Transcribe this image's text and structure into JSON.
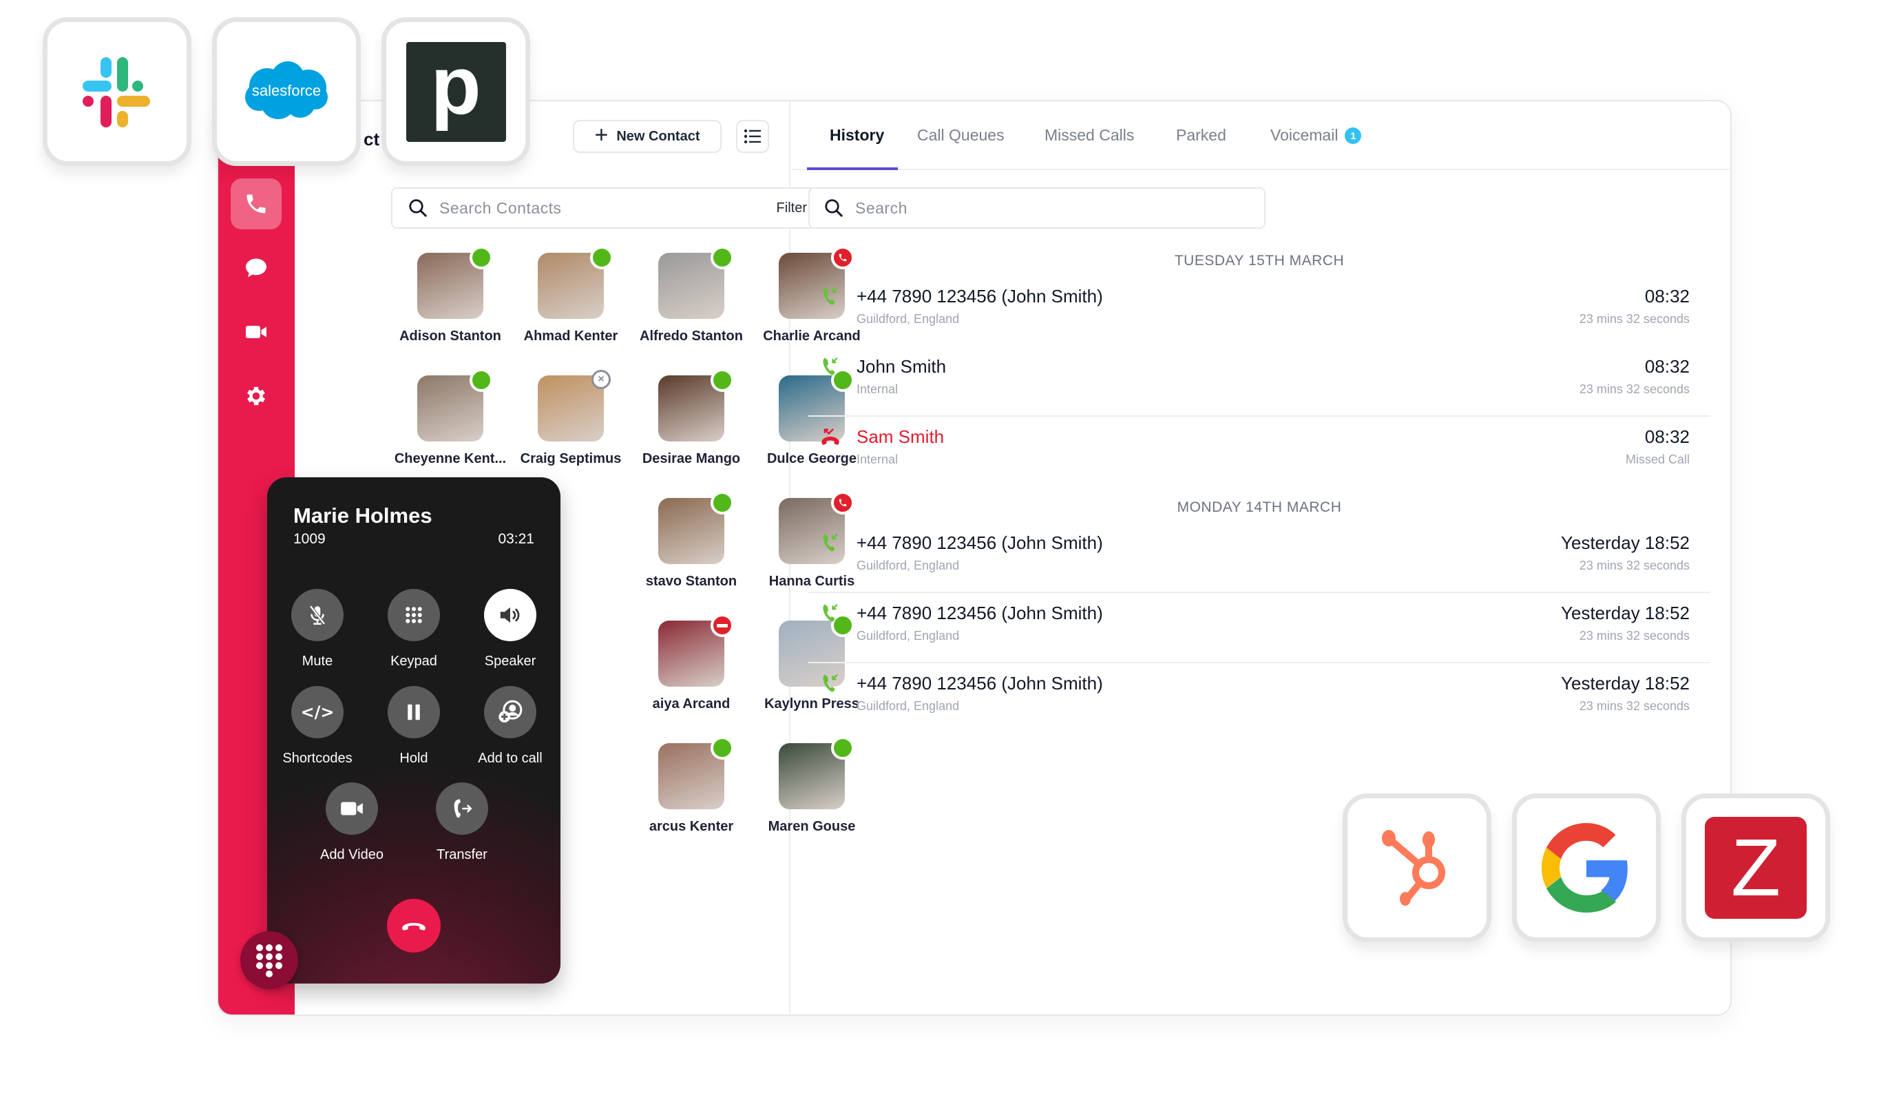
{
  "integrations_top": [
    {
      "name": "Slack",
      "icon": "slack-logo-icon"
    },
    {
      "name": "Salesforce",
      "icon": "salesforce-logo-icon",
      "text": "salesforce"
    },
    {
      "name": "Pipedrive",
      "icon": "pipedrive-logo-icon",
      "text": "p"
    }
  ],
  "integrations_bottom": [
    {
      "name": "HubSpot",
      "icon": "hubspot-logo-icon"
    },
    {
      "name": "Google",
      "icon": "google-logo-icon"
    },
    {
      "name": "Zoho",
      "icon": "zoho-logo-icon",
      "text": "Z"
    }
  ],
  "sidebar": {
    "items": [
      {
        "icon": "phone-icon",
        "label": "Calls",
        "active": true
      },
      {
        "icon": "chat-icon",
        "label": "Messages"
      },
      {
        "icon": "video-icon",
        "label": "Video"
      },
      {
        "icon": "gear-icon",
        "label": "Settings"
      }
    ],
    "accent": "#e91a4c"
  },
  "contacts": {
    "title_partial": "ct",
    "new_contact_label": "New Contact",
    "search_placeholder": "Search Contacts",
    "filter_label": "Filter",
    "list": [
      {
        "name": "Adison Stanton",
        "status": "online",
        "bg": "#8a6a5a"
      },
      {
        "name": "Ahmad Kenter",
        "status": "online",
        "bg": "#b08a68"
      },
      {
        "name": "Alfredo Stanton",
        "status": "online",
        "bg": "#9a9a9a"
      },
      {
        "name": "Charlie Arcand",
        "status": "on-call",
        "bg": "#6b4a3a"
      },
      {
        "name": "Cheyenne Kent...",
        "status": "online",
        "bg": "#8c7868"
      },
      {
        "name": "Craig Septimus",
        "status": "offline",
        "bg": "#c09060"
      },
      {
        "name": "Desirae Mango",
        "status": "online",
        "bg": "#5a3a2a"
      },
      {
        "name": "Dulce George",
        "status": "online",
        "bg": "#2a6a8a"
      },
      {
        "name": "stavo Stanton",
        "status": "online",
        "bg": "#8a6a50"
      },
      {
        "name": "Hanna Curtis",
        "status": "on-call",
        "bg": "#7a6a60"
      },
      {
        "name": "aiya Arcand",
        "status": "dnd",
        "bg": "#8a2a35"
      },
      {
        "name": "Kaylynn Press",
        "status": "online",
        "bg": "#a0b0c0"
      },
      {
        "name": "arcus Kenter",
        "status": "online",
        "bg": "#9a7060"
      },
      {
        "name": "Maren Gouse",
        "status": "online",
        "bg": "#3a4a3a"
      }
    ],
    "status_colors": {
      "online": "#52b81a",
      "on-call": "#e0202a",
      "dnd": "#e0202a",
      "offline": "#ffffff"
    }
  },
  "active_call": {
    "name": "Marie Holmes",
    "extension": "1009",
    "duration": "03:21",
    "controls": [
      {
        "label": "Mute",
        "icon": "mic-off-icon"
      },
      {
        "label": "Keypad",
        "icon": "keypad-icon"
      },
      {
        "label": "Speaker",
        "icon": "speaker-icon",
        "active": true
      },
      {
        "label": "Shortcodes",
        "icon": "code-icon"
      },
      {
        "label": "Hold",
        "icon": "pause-icon"
      },
      {
        "label": "Add to call",
        "icon": "add-user-icon"
      },
      {
        "label": "Add Video",
        "icon": "video-icon"
      },
      {
        "label": "Transfer",
        "icon": "transfer-icon"
      }
    ]
  },
  "history": {
    "tabs": [
      {
        "label": "History",
        "active": true
      },
      {
        "label": "Call Queues"
      },
      {
        "label": "Missed Calls"
      },
      {
        "label": "Parked"
      },
      {
        "label": "Voicemail",
        "badge": "1"
      }
    ],
    "search_placeholder": "Search",
    "groups": [
      {
        "day": "TUESDAY 15TH MARCH",
        "calls": [
          {
            "title": "+44 7890 123456 (John Smith)",
            "sub": "Guildford, England",
            "time": "08:32",
            "detail": "23 mins 32 seconds",
            "type": "incoming"
          },
          {
            "title": "John Smith",
            "sub": "Internal",
            "time": "08:32",
            "detail": "23 mins 32 seconds",
            "type": "incoming"
          },
          {
            "title": "Sam Smith",
            "sub": "Internal",
            "time": "08:32",
            "detail": "Missed Call",
            "type": "missed"
          }
        ]
      },
      {
        "day": "MONDAY 14TH MARCH",
        "calls": [
          {
            "title": "+44 7890 123456 (John Smith)",
            "sub": "Guildford, England",
            "time": "Yesterday 18:52",
            "detail": "23 mins 32 seconds",
            "type": "incoming"
          },
          {
            "title": "+44 7890 123456 (John Smith)",
            "sub": "Guildford, England",
            "time": "Yesterday 18:52",
            "detail": "23 mins 32 seconds",
            "type": "incoming"
          },
          {
            "title": "+44 7890 123456 (John Smith)",
            "sub": "Guildford, England",
            "time": "Yesterday 18:52",
            "detail": "23 mins 32 seconds",
            "type": "incoming"
          }
        ]
      }
    ]
  }
}
